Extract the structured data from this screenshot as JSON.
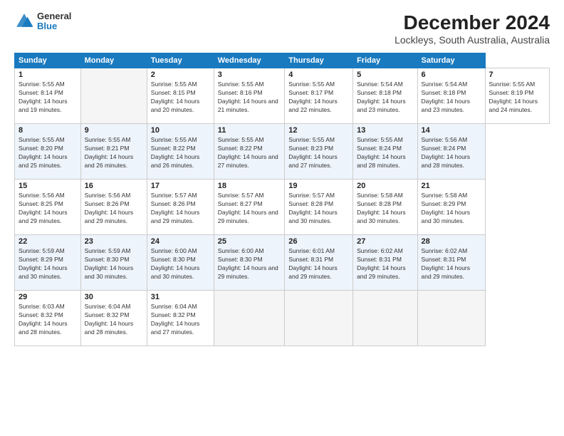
{
  "header": {
    "logo": {
      "general": "General",
      "blue": "Blue"
    },
    "title": "December 2024",
    "subtitle": "Lockleys, South Australia, Australia"
  },
  "calendar": {
    "days_of_week": [
      "Sunday",
      "Monday",
      "Tuesday",
      "Wednesday",
      "Thursday",
      "Friday",
      "Saturday"
    ],
    "weeks": [
      [
        null,
        {
          "day": "2",
          "sunrise": "Sunrise: 5:55 AM",
          "sunset": "Sunset: 8:15 PM",
          "daylight": "Daylight: 14 hours and 20 minutes."
        },
        {
          "day": "3",
          "sunrise": "Sunrise: 5:55 AM",
          "sunset": "Sunset: 8:16 PM",
          "daylight": "Daylight: 14 hours and 21 minutes."
        },
        {
          "day": "4",
          "sunrise": "Sunrise: 5:55 AM",
          "sunset": "Sunset: 8:17 PM",
          "daylight": "Daylight: 14 hours and 22 minutes."
        },
        {
          "day": "5",
          "sunrise": "Sunrise: 5:54 AM",
          "sunset": "Sunset: 8:18 PM",
          "daylight": "Daylight: 14 hours and 23 minutes."
        },
        {
          "day": "6",
          "sunrise": "Sunrise: 5:54 AM",
          "sunset": "Sunset: 8:18 PM",
          "daylight": "Daylight: 14 hours and 23 minutes."
        },
        {
          "day": "7",
          "sunrise": "Sunrise: 5:55 AM",
          "sunset": "Sunset: 8:19 PM",
          "daylight": "Daylight: 14 hours and 24 minutes."
        }
      ],
      [
        {
          "day": "8",
          "sunrise": "Sunrise: 5:55 AM",
          "sunset": "Sunset: 8:20 PM",
          "daylight": "Daylight: 14 hours and 25 minutes."
        },
        {
          "day": "9",
          "sunrise": "Sunrise: 5:55 AM",
          "sunset": "Sunset: 8:21 PM",
          "daylight": "Daylight: 14 hours and 26 minutes."
        },
        {
          "day": "10",
          "sunrise": "Sunrise: 5:55 AM",
          "sunset": "Sunset: 8:22 PM",
          "daylight": "Daylight: 14 hours and 26 minutes."
        },
        {
          "day": "11",
          "sunrise": "Sunrise: 5:55 AM",
          "sunset": "Sunset: 8:22 PM",
          "daylight": "Daylight: 14 hours and 27 minutes."
        },
        {
          "day": "12",
          "sunrise": "Sunrise: 5:55 AM",
          "sunset": "Sunset: 8:23 PM",
          "daylight": "Daylight: 14 hours and 27 minutes."
        },
        {
          "day": "13",
          "sunrise": "Sunrise: 5:55 AM",
          "sunset": "Sunset: 8:24 PM",
          "daylight": "Daylight: 14 hours and 28 minutes."
        },
        {
          "day": "14",
          "sunrise": "Sunrise: 5:56 AM",
          "sunset": "Sunset: 8:24 PM",
          "daylight": "Daylight: 14 hours and 28 minutes."
        }
      ],
      [
        {
          "day": "15",
          "sunrise": "Sunrise: 5:56 AM",
          "sunset": "Sunset: 8:25 PM",
          "daylight": "Daylight: 14 hours and 29 minutes."
        },
        {
          "day": "16",
          "sunrise": "Sunrise: 5:56 AM",
          "sunset": "Sunset: 8:26 PM",
          "daylight": "Daylight: 14 hours and 29 minutes."
        },
        {
          "day": "17",
          "sunrise": "Sunrise: 5:57 AM",
          "sunset": "Sunset: 8:26 PM",
          "daylight": "Daylight: 14 hours and 29 minutes."
        },
        {
          "day": "18",
          "sunrise": "Sunrise: 5:57 AM",
          "sunset": "Sunset: 8:27 PM",
          "daylight": "Daylight: 14 hours and 29 minutes."
        },
        {
          "day": "19",
          "sunrise": "Sunrise: 5:57 AM",
          "sunset": "Sunset: 8:28 PM",
          "daylight": "Daylight: 14 hours and 30 minutes."
        },
        {
          "day": "20",
          "sunrise": "Sunrise: 5:58 AM",
          "sunset": "Sunset: 8:28 PM",
          "daylight": "Daylight: 14 hours and 30 minutes."
        },
        {
          "day": "21",
          "sunrise": "Sunrise: 5:58 AM",
          "sunset": "Sunset: 8:29 PM",
          "daylight": "Daylight: 14 hours and 30 minutes."
        }
      ],
      [
        {
          "day": "22",
          "sunrise": "Sunrise: 5:59 AM",
          "sunset": "Sunset: 8:29 PM",
          "daylight": "Daylight: 14 hours and 30 minutes."
        },
        {
          "day": "23",
          "sunrise": "Sunrise: 5:59 AM",
          "sunset": "Sunset: 8:30 PM",
          "daylight": "Daylight: 14 hours and 30 minutes."
        },
        {
          "day": "24",
          "sunrise": "Sunrise: 6:00 AM",
          "sunset": "Sunset: 8:30 PM",
          "daylight": "Daylight: 14 hours and 30 minutes."
        },
        {
          "day": "25",
          "sunrise": "Sunrise: 6:00 AM",
          "sunset": "Sunset: 8:30 PM",
          "daylight": "Daylight: 14 hours and 29 minutes."
        },
        {
          "day": "26",
          "sunrise": "Sunrise: 6:01 AM",
          "sunset": "Sunset: 8:31 PM",
          "daylight": "Daylight: 14 hours and 29 minutes."
        },
        {
          "day": "27",
          "sunrise": "Sunrise: 6:02 AM",
          "sunset": "Sunset: 8:31 PM",
          "daylight": "Daylight: 14 hours and 29 minutes."
        },
        {
          "day": "28",
          "sunrise": "Sunrise: 6:02 AM",
          "sunset": "Sunset: 8:31 PM",
          "daylight": "Daylight: 14 hours and 29 minutes."
        }
      ],
      [
        {
          "day": "29",
          "sunrise": "Sunrise: 6:03 AM",
          "sunset": "Sunset: 8:32 PM",
          "daylight": "Daylight: 14 hours and 28 minutes."
        },
        {
          "day": "30",
          "sunrise": "Sunrise: 6:04 AM",
          "sunset": "Sunset: 8:32 PM",
          "daylight": "Daylight: 14 hours and 28 minutes."
        },
        {
          "day": "31",
          "sunrise": "Sunrise: 6:04 AM",
          "sunset": "Sunset: 8:32 PM",
          "daylight": "Daylight: 14 hours and 27 minutes."
        },
        null,
        null,
        null,
        null
      ]
    ],
    "week1_day1": {
      "day": "1",
      "sunrise": "Sunrise: 5:55 AM",
      "sunset": "Sunset: 8:14 PM",
      "daylight": "Daylight: 14 hours and 19 minutes."
    }
  }
}
